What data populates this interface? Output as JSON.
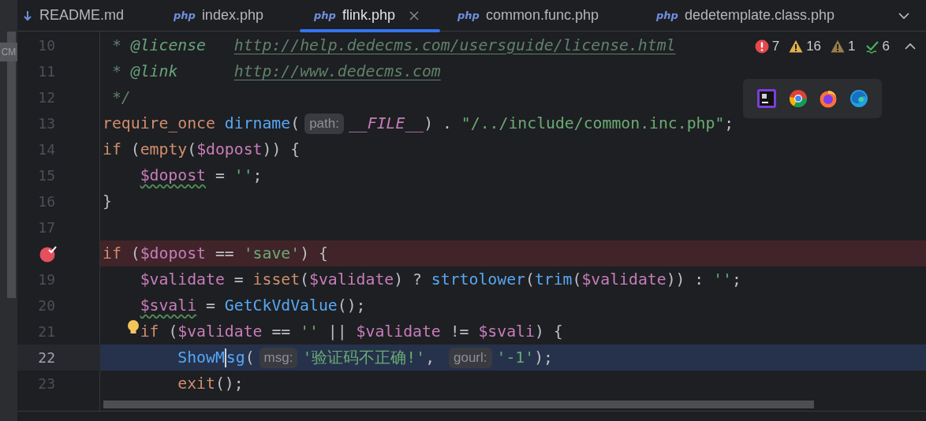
{
  "side_strip": {
    "label": "CM"
  },
  "tabs": [
    {
      "label": "README.md",
      "kind": "markdown",
      "selected": false,
      "closable": false
    },
    {
      "label": "index.php",
      "kind": "php",
      "selected": false,
      "closable": false
    },
    {
      "label": "flink.php",
      "kind": "php",
      "selected": true,
      "closable": true
    },
    {
      "label": "common.func.php",
      "kind": "php",
      "selected": false,
      "closable": false
    },
    {
      "label": "dedetemplate.class.php",
      "kind": "php",
      "selected": false,
      "closable": false
    }
  ],
  "tab_icon_text": "php",
  "inspections": [
    {
      "kind": "error",
      "count": "7"
    },
    {
      "kind": "warning",
      "count": "16"
    },
    {
      "kind": "weak",
      "count": "1"
    },
    {
      "kind": "ok",
      "count": "6"
    }
  ],
  "lines": [
    {
      "number": "10",
      "kind": "normal",
      "tokens": [
        {
          "kind": "comment",
          "text": " * "
        },
        {
          "kind": "doctag",
          "text": "@license   "
        },
        {
          "kind": "link",
          "text": "http://help.dedecms.com/usersguide/license.html"
        }
      ]
    },
    {
      "number": "11",
      "kind": "normal",
      "tokens": [
        {
          "kind": "comment",
          "text": " * "
        },
        {
          "kind": "doctag",
          "text": "@link      "
        },
        {
          "kind": "link",
          "text": "http://www.dedecms.com"
        }
      ]
    },
    {
      "number": "12",
      "kind": "normal",
      "tokens": [
        {
          "kind": "comment",
          "text": " */"
        }
      ]
    },
    {
      "number": "13",
      "kind": "normal",
      "tokens": [
        {
          "kind": "keyword",
          "text": "require_once "
        },
        {
          "kind": "func",
          "text": "dirname"
        },
        {
          "kind": "plain",
          "text": "("
        },
        {
          "kind": "hint",
          "text": "path:"
        },
        {
          "kind": "constant",
          "text": "__FILE__"
        },
        {
          "kind": "plain",
          "text": ") . "
        },
        {
          "kind": "string",
          "text": "\"/../include/common.inc.php\""
        },
        {
          "kind": "plain",
          "text": ";"
        }
      ]
    },
    {
      "number": "14",
      "kind": "normal",
      "tokens": [
        {
          "kind": "keyword",
          "text": "if"
        },
        {
          "kind": "plain",
          "text": " ("
        },
        {
          "kind": "keyword",
          "text": "empty"
        },
        {
          "kind": "plain",
          "text": "("
        },
        {
          "kind": "var",
          "text": "$dopost"
        },
        {
          "kind": "plain",
          "text": ")) {"
        }
      ]
    },
    {
      "number": "15",
      "kind": "normal",
      "tokens": [
        {
          "kind": "var_unused",
          "text": "    $dopost"
        },
        {
          "kind": "plain",
          "text": " = "
        },
        {
          "kind": "string",
          "text": "''"
        },
        {
          "kind": "plain",
          "text": ";"
        }
      ]
    },
    {
      "number": "16",
      "kind": "normal",
      "tokens": [
        {
          "kind": "plain",
          "text": "}"
        }
      ]
    },
    {
      "number": "17",
      "kind": "normal"
    },
    {
      "kind": "breakpoint",
      "tokens": [
        {
          "kind": "keyword",
          "text": "if"
        },
        {
          "kind": "plain",
          "text": " ("
        },
        {
          "kind": "var",
          "text": "$dopost"
        },
        {
          "kind": "plain",
          "text": " == "
        },
        {
          "kind": "string",
          "text": "'save'"
        },
        {
          "kind": "plain",
          "text": ") {"
        }
      ]
    },
    {
      "number": "19",
      "kind": "normal",
      "tokens": [
        {
          "kind": "var",
          "text": "    $validate"
        },
        {
          "kind": "plain",
          "text": " = "
        },
        {
          "kind": "keyword",
          "text": "isset"
        },
        {
          "kind": "plain",
          "text": "("
        },
        {
          "kind": "var",
          "text": "$validate"
        },
        {
          "kind": "plain",
          "text": ") ? "
        },
        {
          "kind": "func",
          "text": "strtolower"
        },
        {
          "kind": "plain",
          "text": "("
        },
        {
          "kind": "func",
          "text": "trim"
        },
        {
          "kind": "plain",
          "text": "("
        },
        {
          "kind": "var",
          "text": "$validate"
        },
        {
          "kind": "plain",
          "text": ")) : "
        },
        {
          "kind": "string",
          "text": "''"
        },
        {
          "kind": "plain",
          "text": ";"
        }
      ]
    },
    {
      "number": "20",
      "kind": "normal",
      "tokens": [
        {
          "kind": "var_unused",
          "text": "    $svali"
        },
        {
          "kind": "plain",
          "text": " = "
        },
        {
          "kind": "func",
          "text": "GetCkVdValue"
        },
        {
          "kind": "plain",
          "text": "();"
        }
      ]
    },
    {
      "number": "21",
      "kind": "bulb",
      "tokens": [
        {
          "kind": "keyword",
          "text": "    if"
        },
        {
          "kind": "plain",
          "text": " ("
        },
        {
          "kind": "var",
          "text": "$validate"
        },
        {
          "kind": "plain",
          "text": " == "
        },
        {
          "kind": "string",
          "text": "''"
        },
        {
          "kind": "plain",
          "text": " || "
        },
        {
          "kind": "var",
          "text": "$validate"
        },
        {
          "kind": "plain",
          "text": " != "
        },
        {
          "kind": "var",
          "text": "$svali"
        },
        {
          "kind": "plain",
          "text": ") {"
        }
      ]
    },
    {
      "number": "22",
      "kind": "current",
      "tokens": [
        {
          "kind": "func",
          "text": "        ShowM"
        },
        {
          "kind": "caret"
        },
        {
          "kind": "func",
          "text": "sg"
        },
        {
          "kind": "plain",
          "text": "("
        },
        {
          "kind": "hint",
          "text": "msg:"
        },
        {
          "kind": "string",
          "text": "'验证码不正确!'"
        },
        {
          "kind": "plain",
          "text": ", "
        },
        {
          "kind": "hint",
          "text": "gourl:"
        },
        {
          "kind": "string",
          "text": "'-1'"
        },
        {
          "kind": "plain",
          "text": ");"
        }
      ]
    },
    {
      "number": "23",
      "kind": "normal",
      "tokens": [
        {
          "kind": "keyword",
          "text": "        exit"
        },
        {
          "kind": "plain",
          "text": "();"
        }
      ]
    }
  ]
}
